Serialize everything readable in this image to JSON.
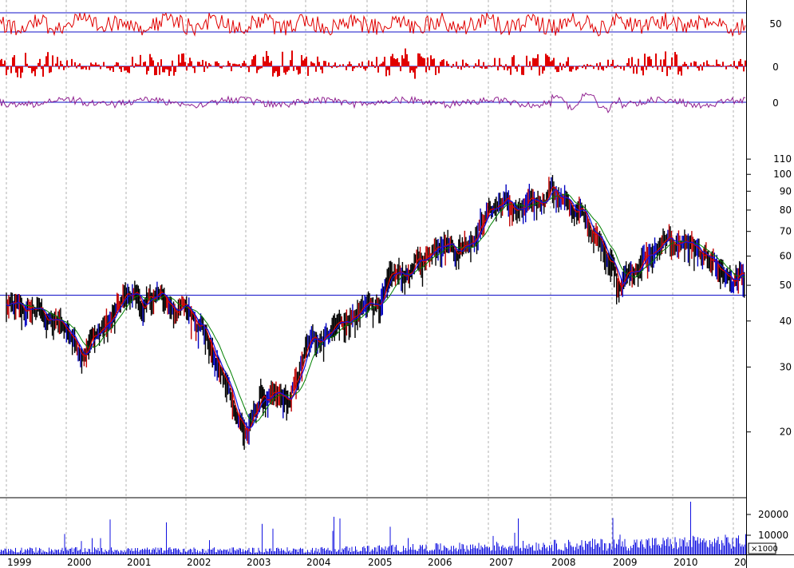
{
  "chart_data": {
    "type": "line",
    "scale": "log",
    "grid": "vertical dashed at year boundaries",
    "x_labels": [
      "1999",
      "2000",
      "2001",
      "2002",
      "2003",
      "2004",
      "2005",
      "2006",
      "2007",
      "2008",
      "2009",
      "2010",
      "20"
    ],
    "price_axis": {
      "ticks": [
        "110",
        "100",
        "90",
        "80",
        "70",
        "60",
        "50",
        "40",
        "30",
        "20"
      ],
      "ylim": [
        17,
        115
      ]
    },
    "horizontal_reference": 47,
    "price": {
      "x": [
        1999.0,
        1999.25,
        1999.5,
        1999.75,
        2000.0,
        2000.25,
        2000.5,
        2000.75,
        2001.0,
        2001.15,
        2001.3,
        2001.5,
        2001.75,
        2002.0,
        2002.25,
        2002.5,
        2002.75,
        2003.0,
        2003.1,
        2003.25,
        2003.5,
        2003.75,
        2004.0,
        2004.25,
        2004.5,
        2004.75,
        2005.0,
        2005.25,
        2005.5,
        2005.75,
        2006.0,
        2006.25,
        2006.5,
        2006.75,
        2007.0,
        2007.25,
        2007.5,
        2007.75,
        2007.9,
        2008.0,
        2008.25,
        2008.5,
        2008.75,
        2009.0,
        2009.1,
        2009.25,
        2009.5,
        2009.75,
        2010.0,
        2010.25,
        2010.5,
        2010.75,
        2011.0,
        2011.1,
        2011.2
      ],
      "values": [
        44,
        42,
        43,
        40,
        38,
        34,
        37,
        40,
        46,
        48,
        43,
        47,
        44,
        43,
        41,
        31,
        25,
        20,
        21,
        25,
        24,
        24,
        33,
        37,
        40,
        40,
        43,
        47,
        52,
        55,
        60,
        70,
        63,
        70,
        80,
        85,
        78,
        82,
        88,
        95,
        82,
        78,
        70,
        60,
        48,
        54,
        58,
        62,
        65,
        67,
        60,
        53,
        49,
        52,
        49
      ]
    },
    "volume_axis": {
      "ticks": [
        "20000",
        "10000"
      ],
      "unit": "×1000"
    },
    "indicators": [
      {
        "name": "",
        "axis_label": "50"
      },
      {
        "name": "",
        "axis_label": "0"
      },
      {
        "name": "",
        "axis_label": "0"
      }
    ]
  }
}
